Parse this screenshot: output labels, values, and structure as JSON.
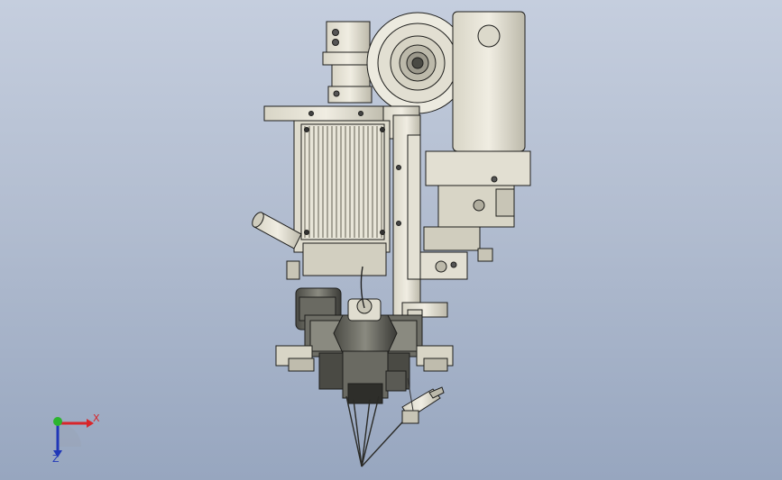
{
  "viewport": {
    "background_top": "#c5cede",
    "background_bottom": "#97a6bf",
    "model_description_icon": "laser-cladding-head-assembly"
  },
  "triad": {
    "x_label": "X",
    "z_label": "Z",
    "x_color": "#d8262b",
    "y_color": "#2bb52e",
    "z_color": "#2037b8"
  },
  "colors": {
    "metal_light": "#e6e3d6",
    "metal_mid": "#c8c5b6",
    "metal_dark": "#7d7b70",
    "outline": "#1e1e1c",
    "dark_part": "#3c3c38"
  }
}
